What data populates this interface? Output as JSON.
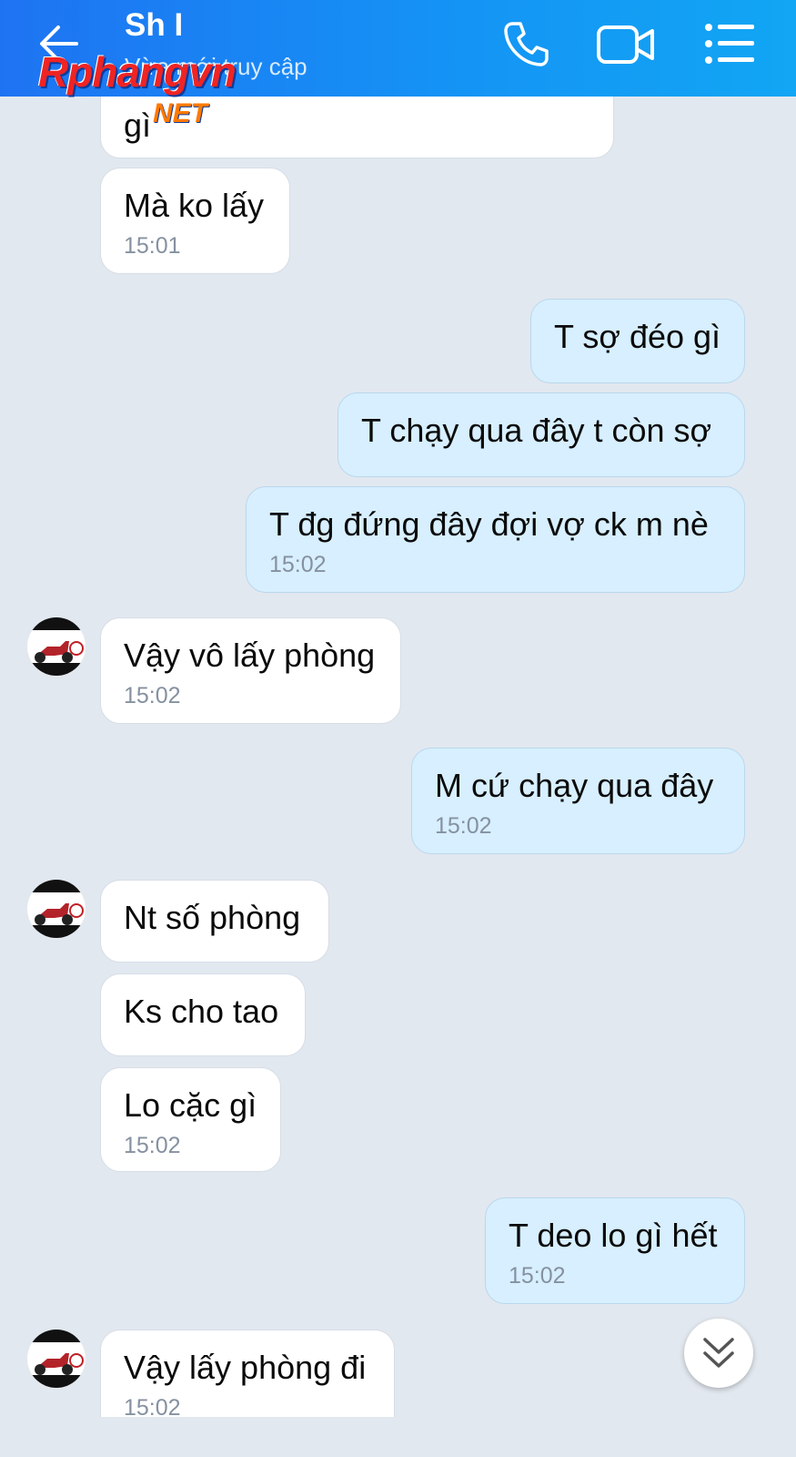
{
  "header": {
    "contact_name": "Sh I",
    "status": "Vừa mới truy cập",
    "back_icon": "arrow-left-icon",
    "call_icon": "phone-icon",
    "video_icon": "video-camera-icon",
    "menu_icon": "list-menu-icon"
  },
  "watermark": {
    "main": "Rphangvn",
    "suffix": "NET"
  },
  "colors": {
    "header_start": "#1e73f2",
    "header_end": "#12a6f4",
    "incoming_bubble": "#ffffff",
    "outgoing_bubble": "#d7efff",
    "background": "#e2e8ef"
  },
  "messages": [
    {
      "dir": "in",
      "text": "gì",
      "time": ""
    },
    {
      "dir": "in",
      "text": "Mà ko lấy",
      "time": "15:01"
    },
    {
      "dir": "out",
      "text": "T sợ đéo gì",
      "time": ""
    },
    {
      "dir": "out",
      "text": "T chạy qua đây t còn sợ",
      "time": ""
    },
    {
      "dir": "out",
      "text": "T đg đứng đây đợi vợ ck m nè",
      "time": "15:02"
    },
    {
      "dir": "in",
      "text": "Vậy vô lấy phòng",
      "time": "15:02",
      "avatar": true
    },
    {
      "dir": "out",
      "text": "M cứ chạy qua đây",
      "time": "15:02"
    },
    {
      "dir": "in",
      "text": "Nt số phòng",
      "time": "",
      "avatar": true
    },
    {
      "dir": "in",
      "text": "Ks cho tao",
      "time": ""
    },
    {
      "dir": "in",
      "text": "Lo cặc gì",
      "time": "15:02"
    },
    {
      "dir": "out",
      "text": "T deo lo gì hết",
      "time": "15:02"
    },
    {
      "dir": "in",
      "text": "Vậy lấy phòng đi",
      "time": "15:02",
      "avatar": true
    }
  ],
  "scroll_down_icon": "double-chevron-down-icon"
}
